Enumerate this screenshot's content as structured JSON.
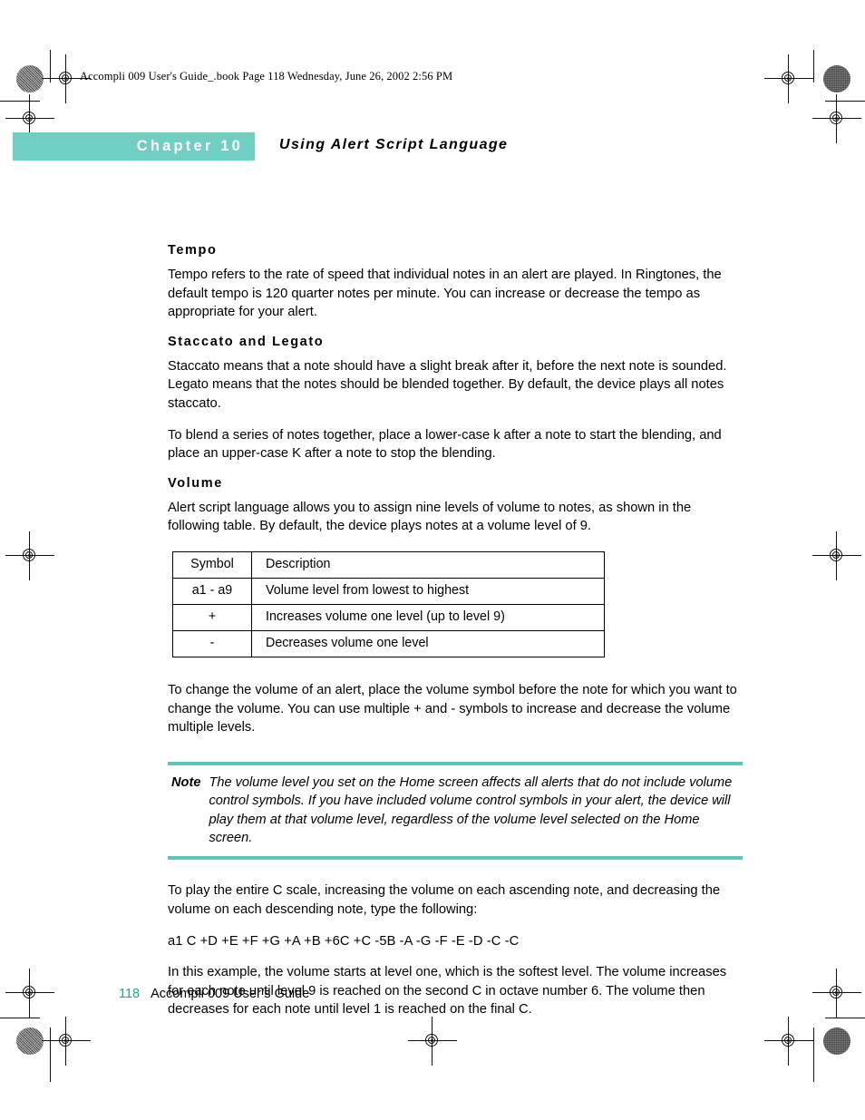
{
  "print_marks": {
    "file_stamp": "Accompli 009 User's Guide_.book  Page 118  Wednesday, June 26, 2002  2:56 PM"
  },
  "header": {
    "chapter_label": "Chapter 10",
    "chapter_title": "Using Alert Script Language",
    "band_color": "#71cec2"
  },
  "sections": {
    "tempo": {
      "heading": "Tempo",
      "paragraph": "Tempo refers to the rate of speed that individual notes in an alert are played. In Ringtones, the default tempo is 120 quarter notes per minute. You can increase or decrease the tempo as appropriate for your alert."
    },
    "staccato": {
      "heading": "Staccato and Legato",
      "paragraph_1": "Staccato means that a note should have a slight break after it, before the next note is sounded. Legato means that the notes should be blended together. By default, the device plays all notes staccato.",
      "paragraph_2": "To blend a series of notes together, place a lower-case k after a note to start the blending, and place an upper-case K after a note to stop the blending."
    },
    "volume": {
      "heading": "Volume",
      "paragraph_1": "Alert script language allows you to assign nine levels of volume to notes, as shown in the following table. By default, the device plays notes at a volume level of 9.",
      "paragraph_2": "To change the volume of an alert, place the volume symbol before the note for which you want to change the volume. You can use multiple + and - symbols to increase and decrease the volume multiple levels.",
      "paragraph_3": "To play the entire C scale, increasing the volume on each ascending note, and decreasing the volume on each descending note, type the following:",
      "code_example": "a1 C +D +E +F +G +A +B +6C +C -5B -A -G -F -E -D -C -C",
      "paragraph_4": "In this example, the volume starts at level one, which is the softest level. The volume increases for each note until level 9 is reached on the second C in octave number 6. The volume then decreases for each note until level 1 is reached on the final C."
    }
  },
  "volume_table": {
    "headers": [
      "Symbol",
      "Description"
    ],
    "rows": [
      [
        "a1 - a9",
        "Volume level from lowest to highest"
      ],
      [
        "+",
        "Increases volume one level (up to level 9)"
      ],
      [
        "-",
        "Decreases volume one level"
      ]
    ]
  },
  "note_callout": {
    "label": "Note",
    "text": "The volume level you set on the Home screen affects all alerts that do not include volume control symbols. If you have included volume control symbols in your alert, the device will play them at that volume level, regardless of the volume level selected on the Home screen.",
    "rule_color": "#5cc6b8"
  },
  "footer": {
    "page_number": "118",
    "guide_title": "Accompli 009 User’s Guide",
    "page_number_color": "#22a58f"
  }
}
